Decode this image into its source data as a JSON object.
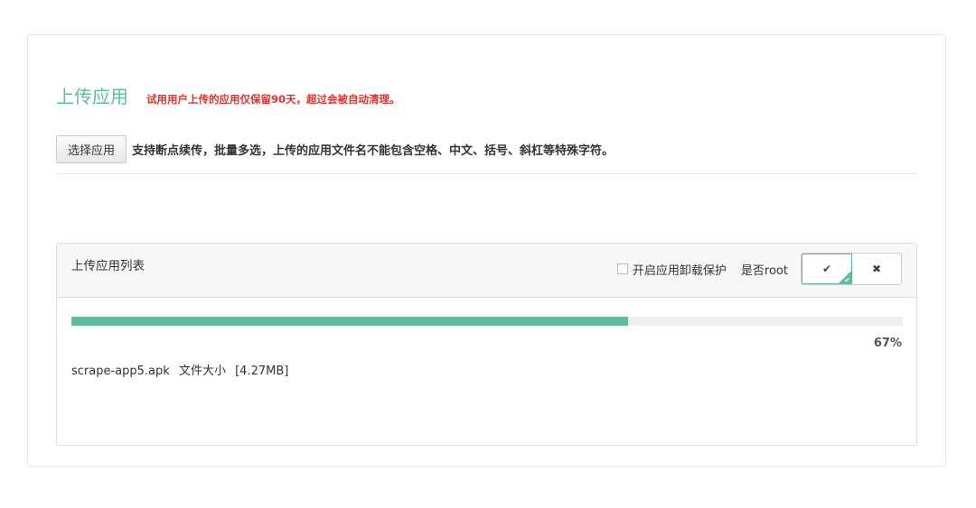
{
  "header": {
    "title": "上传应用",
    "retention_note": "试用用户上传的应用仅保留90天，超过会被自动清理。"
  },
  "upload": {
    "select_button_label": "选择应用",
    "hint": "支持断点续传，批量多选，上传的应用文件名不能包含空格、中文、括号、斜杠等特殊字符。"
  },
  "list": {
    "title": "上传应用列表",
    "protect_label": "开启应用卸载保护",
    "protect_checked": false,
    "root_label": "是否root",
    "root_selected": "yes",
    "toggle_yes_icon": "check-icon",
    "toggle_no_icon": "times-icon"
  },
  "items": [
    {
      "file_name": "scrape-app5.apk",
      "size_label": "文件大小",
      "size_value": "[4.27MB]",
      "progress_percent": 67,
      "progress_label": "67%"
    }
  ],
  "colors": {
    "accent": "#5cbd9a",
    "warning": "#e0322f"
  }
}
